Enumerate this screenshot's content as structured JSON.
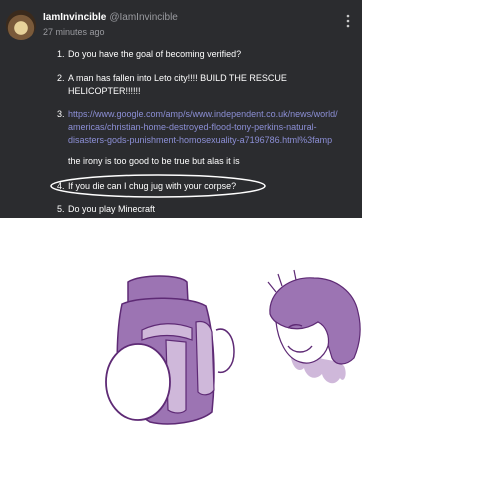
{
  "post": {
    "username": "IamInvincible",
    "handle": "@IamInvincible",
    "timestamp": "27 minutes ago",
    "items": [
      {
        "num": "1.",
        "text": "Do you have the goal of becoming verified?"
      },
      {
        "num": "2.",
        "line1": "A man has fallen into Leto city!!!! BUILD THE RESCUE",
        "line2": "HELICOPTER!!!!!!"
      },
      {
        "num": "3.",
        "link1": "https://www.google.com/amp/s/www.independent.co.uk/news/world/",
        "link2": "americas/christian-home-destroyed-flood-tony-perkins-natural-",
        "link3": "disasters-gods-punishment-homosexuality-a7196786.html%3famp",
        "after": "the irony is too good to be true but alas it is"
      },
      {
        "num": "4.",
        "text": "If you die can I chug jug with your corpse?"
      },
      {
        "num": "5.",
        "text": "Do you play Minecraft"
      }
    ]
  },
  "colors": {
    "post_bg": "#2b2c2f",
    "link": "#8c8fd6",
    "drawing_purple": "#9c74b3",
    "drawing_light_purple": "#cfb8da",
    "drawing_outline": "#5e2a75"
  },
  "icons": {
    "menu": "vertical-ellipsis-icon",
    "avatar": "avatar-image"
  }
}
